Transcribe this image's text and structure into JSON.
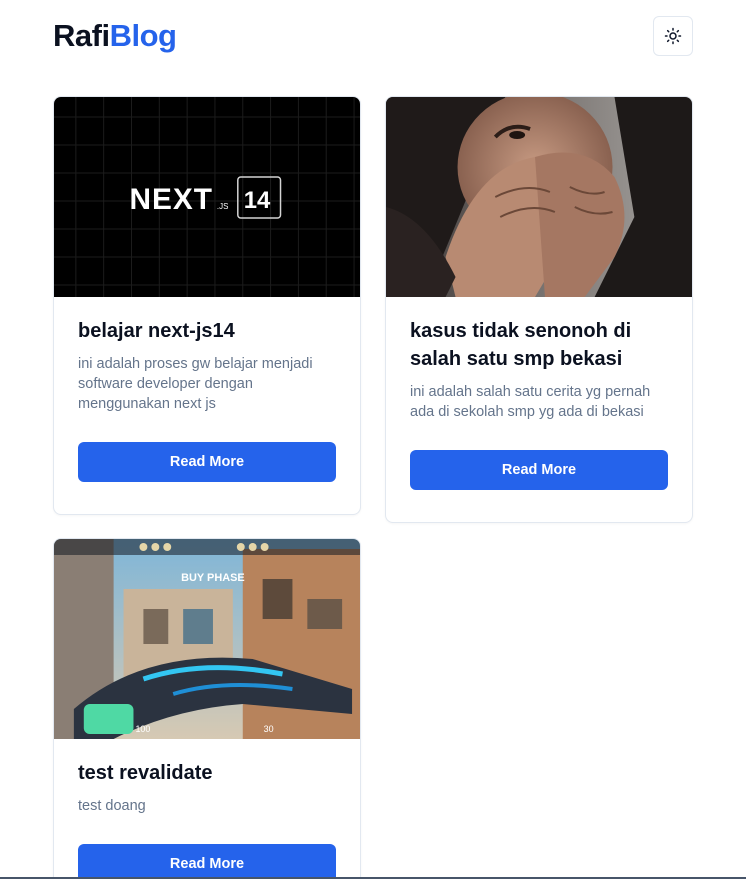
{
  "header": {
    "brand_part1": "Rafi",
    "brand_part2": "Blog",
    "theme_toggle_icon": "sun-icon"
  },
  "posts": [
    {
      "title": "belajar next-js14",
      "description": "ini adalah proses gw belajar menjadi software developer dengan menggunakan next js",
      "button_label": "Read More",
      "image_alt": "NEXT.JS 14",
      "image_text_main": "NEXT",
      "image_text_sub": ".JS",
      "image_text_badge": "14"
    },
    {
      "title": "kasus tidak senonoh di salah satu smp bekasi",
      "description": "ini adalah salah satu cerita yg pernah ada di sekolah smp yg ada di bekasi",
      "button_label": "Read More",
      "image_alt": "frightened person covering face"
    },
    {
      "title": "test revalidate",
      "description": "test doang",
      "button_label": "Read More",
      "image_alt": "game screenshot",
      "image_text_main": "BUY PHASE",
      "image_hud_ammo": "30",
      "image_hud_health": "100"
    }
  ],
  "colors": {
    "accent": "#2563eb",
    "title": "#0b1120",
    "muted": "#64748b",
    "border": "#e2e8f0"
  }
}
